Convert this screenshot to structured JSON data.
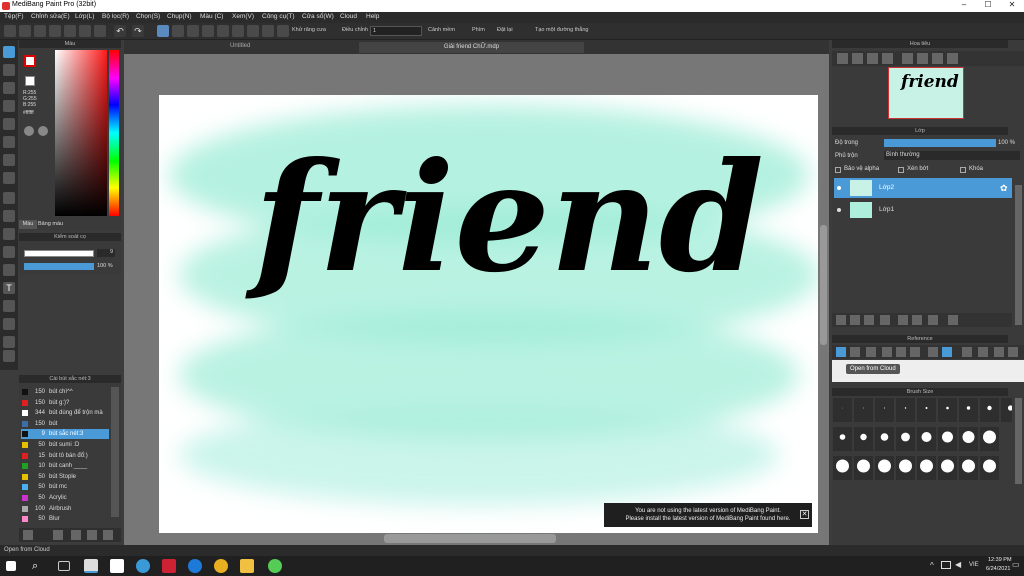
{
  "window": {
    "title": "MediBang Paint Pro (32bit)",
    "min": "–",
    "max": "☐",
    "close": "✕"
  },
  "menu": [
    "Tệp(F)",
    "Chỉnh sửa(E)",
    "Lớp(L)",
    "Bộ lọc(R)",
    "Chọn(S)",
    "Chụp(N)",
    "Màu (C)",
    "Xem(V)",
    "Công cụ(T)",
    "Cửa sổ(W)",
    "Cloud",
    "Help"
  ],
  "toolbar": {
    "antialias": "Khử răng cưa",
    "correction_label": "Điều chỉnh",
    "correction_value": "1",
    "hand_correction": "Cảnh mềm",
    "pressure": "Phím",
    "fill": "Đặt lại",
    "straight": "Tạo một đường thẳng"
  },
  "tabs": {
    "untitled": "Untitled",
    "file": "Giải friend ChỮ.mdp"
  },
  "color_panel": {
    "title": "Màu",
    "r": "R:255",
    "g": "G:255",
    "b": "B:255",
    "hex": "#ffffff",
    "tab1": "Màu",
    "tab2": "Bảng màu"
  },
  "brush_control": {
    "title": "Kiểm soát cọ",
    "size": "9",
    "opacity": "100 %"
  },
  "brush_list": {
    "title": "Cài bút sắc nét:3",
    "items": [
      {
        "size": "150",
        "name": "bút chì^^",
        "color": "#111111"
      },
      {
        "size": "150",
        "name": "bút g:)?",
        "color": "#e02020"
      },
      {
        "size": "344",
        "name": "bút dùng để trộn mà",
        "color": "#ffffff"
      },
      {
        "size": "150",
        "name": "bút",
        "color": "#3b6ea5"
      },
      {
        "size": "9",
        "name": "bút sắc nét:3",
        "color": "#111111"
      },
      {
        "size": "50",
        "name": "bút sumi :D",
        "color": "#e6c000"
      },
      {
        "size": "15",
        "name": "bút tô bán đổ:)",
        "color": "#e02020"
      },
      {
        "size": "10",
        "name": "bút canh ____",
        "color": "#20a020"
      },
      {
        "size": "50",
        "name": "bút Stople",
        "color": "#e6c000"
      },
      {
        "size": "50",
        "name": "bút mc",
        "color": "#4ab0f0"
      },
      {
        "size": "50",
        "name": "Acrylic",
        "color": "#cc33cc"
      },
      {
        "size": "100",
        "name": "Airbrush",
        "color": "#aaaaaa"
      },
      {
        "size": "50",
        "name": "Blur",
        "color": "#ff88cc"
      }
    ]
  },
  "canvas": {
    "text": "friend"
  },
  "notice": {
    "line1": "You are not using the latest version of MediBang Paint.",
    "line2": "Please install the latest version of MediBang Paint found here."
  },
  "navigator": {
    "title": "Hoa tiêu"
  },
  "layer_panel": {
    "title": "Lớp",
    "opacity_label": "Độ trong",
    "opacity_value": "100 %",
    "blend_label": "Phủ trộn",
    "blend_value": "Bình thường",
    "protect_alpha": "Bảo vệ alpha",
    "clipping": "Xén bớt",
    "lock": "Khóa",
    "layers": [
      {
        "name": "Lớp2"
      },
      {
        "name": "Lớp1"
      }
    ]
  },
  "reference": {
    "title": "Reference",
    "tooltip": "Open from Cloud"
  },
  "brush_size": {
    "title": "Brush Size",
    "row1": [
      "",
      "",
      "",
      "",
      "",
      "",
      "",
      "",
      ""
    ],
    "row2": [
      "12",
      "15",
      "20",
      "25",
      "30",
      "40",
      "50",
      "70"
    ],
    "row3": [
      "100",
      "150",
      "200",
      "300",
      "400",
      "500",
      "700",
      "1000"
    ]
  },
  "status": "Open from Cloud",
  "clock": {
    "time": "12:39 PM",
    "date": "6/24/2021",
    "lang": "VIE"
  },
  "colors": {
    "accent": "#4a9ad8",
    "mint": "#8fe8d0"
  }
}
